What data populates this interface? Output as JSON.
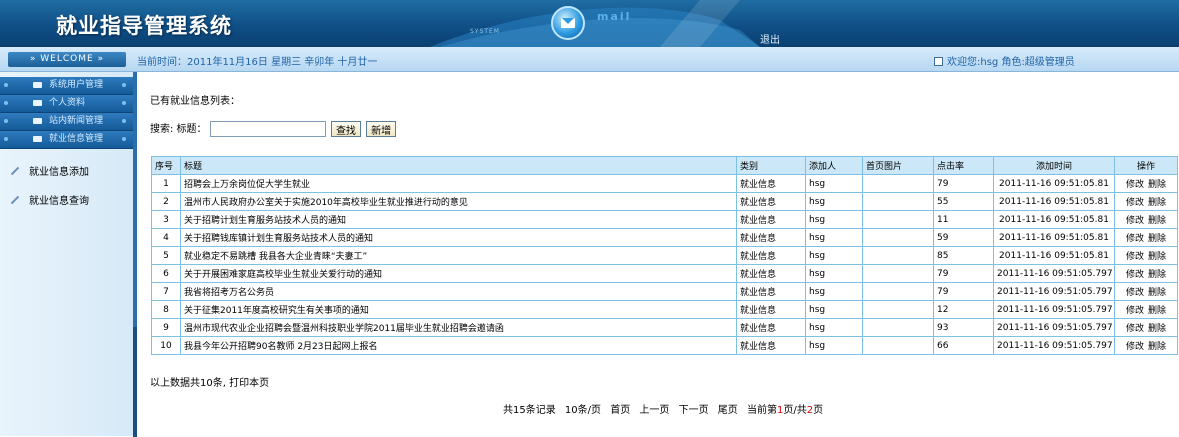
{
  "header": {
    "title": "就业指导管理系统",
    "system_tag": "SYSTEM",
    "mail_text": "mail",
    "logout_label": "退出"
  },
  "status": {
    "welcome": "WELCOME",
    "current_time": "当前时间：2011年11月16日 星期三 辛卯年 十月廿一",
    "user_info": "欢迎您:hsg 角色:超级管理员"
  },
  "sidebar": {
    "menu": [
      {
        "label": "系统用户管理"
      },
      {
        "label": "个人资料"
      },
      {
        "label": "站内新闻管理"
      },
      {
        "label": "就业信息管理"
      }
    ],
    "sub_items": [
      {
        "label": "就业信息添加"
      },
      {
        "label": "就业信息查询"
      }
    ]
  },
  "content": {
    "list_title": "已有就业信息列表：",
    "search": {
      "label": "搜索: 标题：",
      "placeholder": "",
      "search_button": "查找",
      "add_button": "新增"
    },
    "columns": [
      "序号",
      "标题",
      "类别",
      "添加人",
      "首页图片",
      "点击率",
      "添加时间",
      "操作"
    ],
    "rows": [
      {
        "no": "1",
        "title": "招聘会上万余岗位促大学生就业",
        "category": "就业信息",
        "author": "hsg",
        "image": "",
        "clicks": "79",
        "time": "2011-11-16 09:51:05.81",
        "edit": "修改",
        "delete": "删除"
      },
      {
        "no": "2",
        "title": "温州市人民政府办公室关于实施2010年高校毕业生就业推进行动的意见",
        "category": "就业信息",
        "author": "hsg",
        "image": "",
        "clicks": "55",
        "time": "2011-11-16 09:51:05.81",
        "edit": "修改",
        "delete": "删除"
      },
      {
        "no": "3",
        "title": "关于招聘计划生育服务站技术人员的通知",
        "category": "就业信息",
        "author": "hsg",
        "image": "",
        "clicks": "11",
        "time": "2011-11-16 09:51:05.81",
        "edit": "修改",
        "delete": "删除"
      },
      {
        "no": "4",
        "title": "关于招聘钱库镇计划生育服务站技术人员的通知",
        "category": "就业信息",
        "author": "hsg",
        "image": "",
        "clicks": "59",
        "time": "2011-11-16 09:51:05.81",
        "edit": "修改",
        "delete": "删除"
      },
      {
        "no": "5",
        "title": "就业稳定不易跳槽 我县各大企业青睐“夫妻工”",
        "category": "就业信息",
        "author": "hsg",
        "image": "",
        "clicks": "85",
        "time": "2011-11-16 09:51:05.81",
        "edit": "修改",
        "delete": "删除"
      },
      {
        "no": "6",
        "title": "关于开展困难家庭高校毕业生就业关爱行动的通知",
        "category": "就业信息",
        "author": "hsg",
        "image": "",
        "clicks": "79",
        "time": "2011-11-16 09:51:05.797",
        "edit": "修改",
        "delete": "删除"
      },
      {
        "no": "7",
        "title": "我省将招考万名公务员",
        "category": "就业信息",
        "author": "hsg",
        "image": "",
        "clicks": "79",
        "time": "2011-11-16 09:51:05.797",
        "edit": "修改",
        "delete": "删除"
      },
      {
        "no": "8",
        "title": "关于征集2011年度高校研究生有关事项的通知",
        "category": "就业信息",
        "author": "hsg",
        "image": "",
        "clicks": "12",
        "time": "2011-11-16 09:51:05.797",
        "edit": "修改",
        "delete": "删除"
      },
      {
        "no": "9",
        "title": "温州市现代农业企业招聘会暨温州科技职业学院2011届毕业生就业招聘会邀请函",
        "category": "就业信息",
        "author": "hsg",
        "image": "",
        "clicks": "93",
        "time": "2011-11-16 09:51:05.797",
        "edit": "修改",
        "delete": "删除"
      },
      {
        "no": "10",
        "title": "我县今年公开招聘90名教师 2月23日起网上报名",
        "category": "就业信息",
        "author": "hsg",
        "image": "",
        "clicks": "66",
        "time": "2011-11-16 09:51:05.797",
        "edit": "修改",
        "delete": "删除"
      }
    ],
    "summary": "以上数据共10条, 打印本页",
    "pager": {
      "total": "共15条记录",
      "per_page": "10条/页",
      "first": "首页",
      "prev": "上一页",
      "next": "下一页",
      "last": "尾页",
      "current_prefix": "当前第",
      "current_page": "1",
      "current_mid": "页/共",
      "total_pages": "2",
      "current_suffix": "页"
    }
  },
  "colors": {
    "header_blue": "#0f4f86",
    "status_bar": "#c8e1f5",
    "menu_blue": "#1f6aa8",
    "table_header": "#cce8f8",
    "table_border": "#7fc0e5",
    "page_red": "#e00000"
  }
}
